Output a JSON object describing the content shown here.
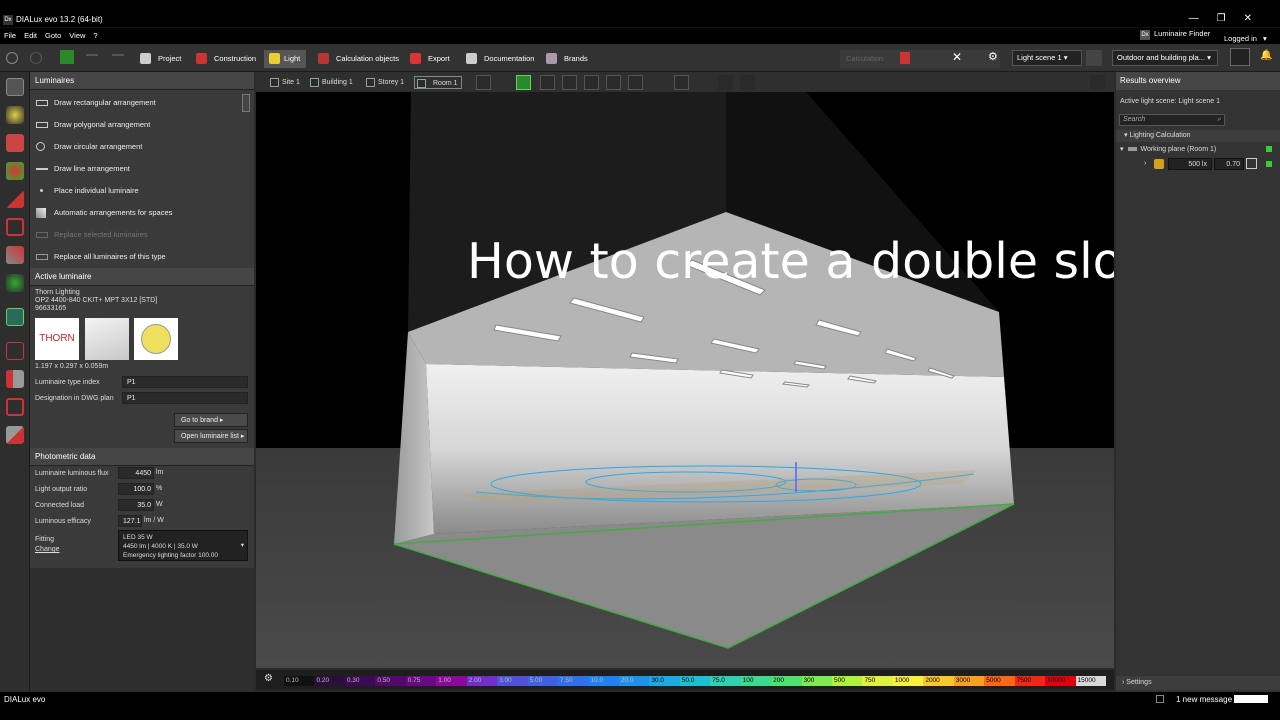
{
  "window": {
    "title": "DIALux evo 13.2  (64-bit)",
    "logo": "Dx",
    "controls": [
      "—",
      "❐",
      "✕"
    ]
  },
  "menu": {
    "items": [
      "File",
      "Edit",
      "Goto",
      "View",
      "?"
    ],
    "luminaire_finder": "Luminaire Finder",
    "logged_in": "Logged in"
  },
  "toolbar": {
    "items": [
      "Project",
      "Construction",
      "Light",
      "Calculation objects",
      "Export",
      "Documentation",
      "Brands"
    ],
    "calculation": "Calculation",
    "light_scene": "Light scene 1",
    "outdoor": "Outdoor and building pla..."
  },
  "luminaires": {
    "title": "Luminaires",
    "items": [
      "Draw rectangular arrangement",
      "Draw polygonal arrangement",
      "Draw circular arrangement",
      "Draw line arrangement",
      "Place individual luminaire",
      "Automatic arrangements for spaces",
      "Replace selected luminaires",
      "Replace all luminaires of this type"
    ]
  },
  "active": {
    "title": "Active luminaire",
    "manufacturer": "Thorn Lighting",
    "model": "OP2 4400-840 CKIT+ MPT 3X12 [STD]",
    "article": "96633165",
    "logo": "THORN",
    "dimensions": "1.197 x 0.297 x 0.059m",
    "type_index_label": "Luminaire type index",
    "type_index": "P1",
    "designation_label": "Designation in DWG plan",
    "designation": "P1",
    "goto_brand": "Go to brand",
    "open_list": "Open luminaire list"
  },
  "photometric": {
    "title": "Photometric data",
    "rows": [
      {
        "label": "Luminaire luminous flux",
        "value": "4450",
        "unit": "lm"
      },
      {
        "label": "Light output ratio",
        "value": "100.0",
        "unit": "%"
      },
      {
        "label": "Connected load",
        "value": "35.0",
        "unit": "W"
      },
      {
        "label": "Luminous efficacy",
        "value": "127.1",
        "unit": "lm / W"
      }
    ],
    "fitting_label": "Fitting",
    "change": "Change",
    "fitting_l1": "LED 35 W",
    "fitting_l2": "4450 lm  |  4000 K  |  35.0 W",
    "fitting_l3": "Emergency lighting factor 100.00"
  },
  "breadcrumb": [
    "Site 1",
    "Building 1",
    "Storey 1",
    "Room 1"
  ],
  "heading": "How to create a double sloped ceiling",
  "scale": {
    "values": [
      "0.10",
      "0.20",
      "0.30",
      "0.50",
      "0.75",
      "1.00",
      "2.00",
      "3.00",
      "5.00",
      "7.50",
      "10.0",
      "20.0",
      "30.0",
      "50.0",
      "75.0",
      "100",
      "200",
      "300",
      "500",
      "750",
      "1000",
      "2000",
      "3000",
      "5000",
      "7500",
      "10000",
      "15000"
    ],
    "colors": [
      "#111111",
      "#2b0f3a",
      "#3a0a52",
      "#520a6a",
      "#6a0a82",
      "#8a0a9a",
      "#7030c8",
      "#5050d8",
      "#4060e0",
      "#3070e8",
      "#2080f0",
      "#2090e8",
      "#20a8e0",
      "#20c0d0",
      "#30d0b0",
      "#40d890",
      "#50e070",
      "#80e850",
      "#b0f040",
      "#e0f040",
      "#f8f040",
      "#f8c830",
      "#f8a020",
      "#f86818",
      "#f02818",
      "#e00010",
      "#d8d8d8"
    ]
  },
  "results": {
    "title": "Results overview",
    "active_scene": "Active light scene: Light scene 1",
    "search": "Search",
    "lighting_calc": "Lighting Calculation",
    "working_plane": "Working plane (Room 1)",
    "value": "500 lx",
    "ratio": "0.70",
    "settings": "Settings"
  },
  "status": {
    "app": "DIALux evo",
    "message": "1 new message"
  }
}
